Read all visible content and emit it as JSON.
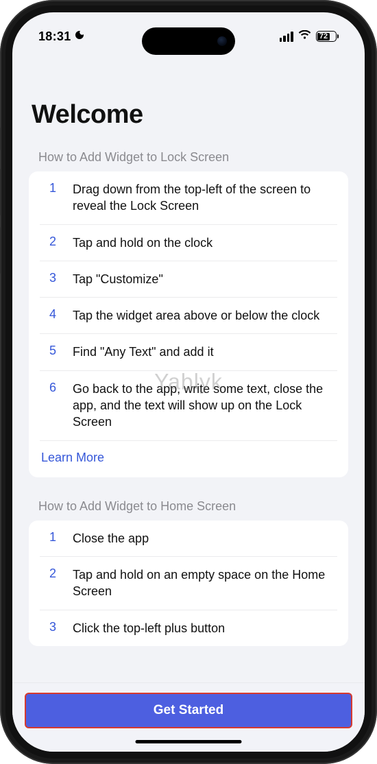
{
  "status": {
    "time": "18:31",
    "battery_percent": "72"
  },
  "page": {
    "title": "Welcome"
  },
  "sections": [
    {
      "heading": "How to Add Widget to Lock Screen",
      "steps": [
        "Drag down from the top-left of the screen to reveal the Lock Screen",
        "Tap and hold on the clock",
        "Tap \"Customize\"",
        "Tap the widget area above or below the clock",
        "Find \"Any Text\" and add it",
        "Go back to the app, write some text, close the app, and the text will show up on the Lock Screen"
      ],
      "learn_more": "Learn More"
    },
    {
      "heading": "How to Add Widget to Home Screen",
      "steps": [
        "Close the app",
        "Tap and hold on an empty space on the Home Screen",
        "Click the top-left plus button"
      ]
    }
  ],
  "footer": {
    "cta_label": "Get Started"
  },
  "watermark": "Yablyk"
}
